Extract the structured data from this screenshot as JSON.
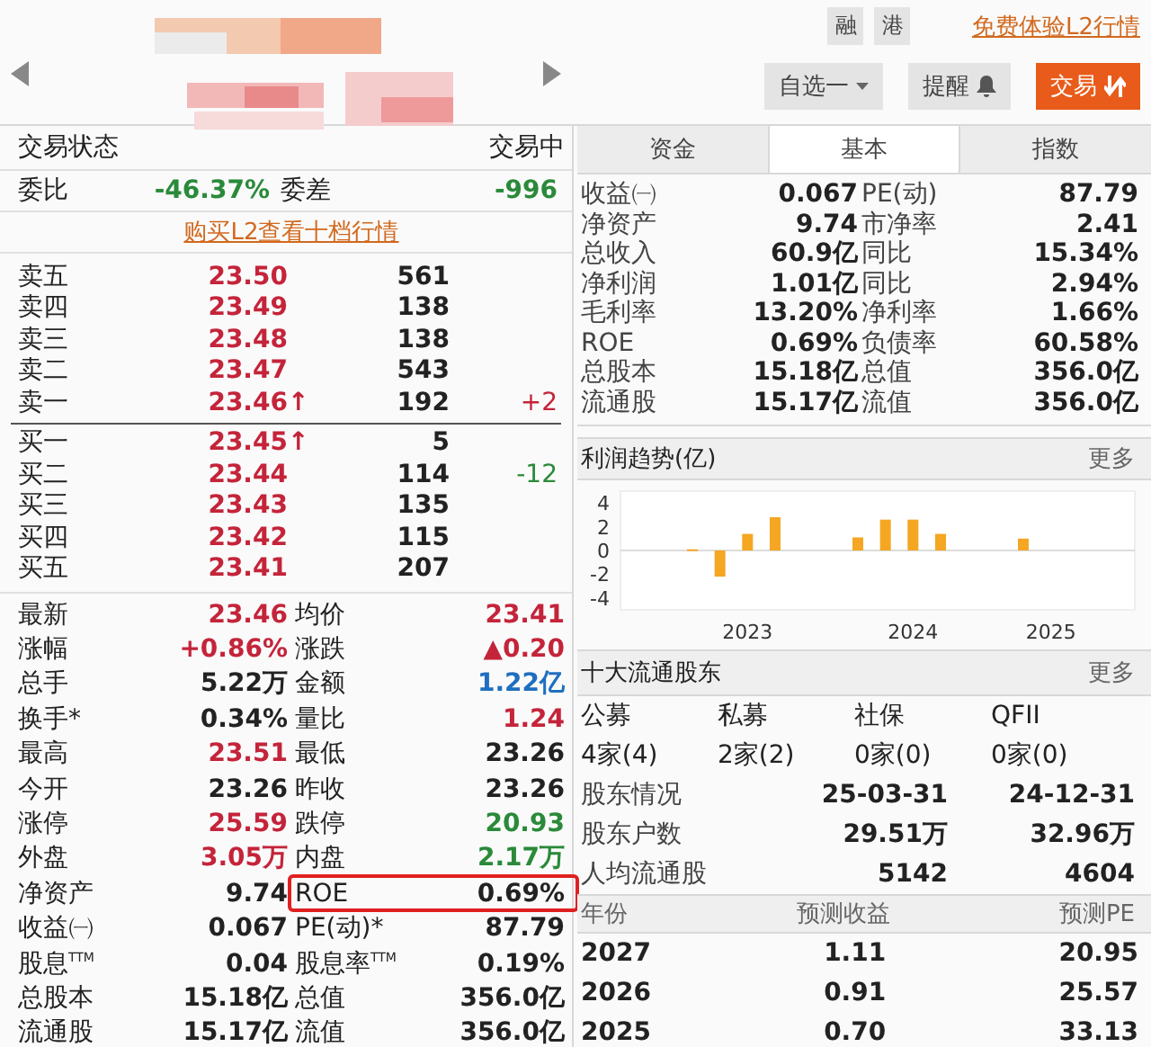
{
  "header": {
    "tags": [
      "融",
      "港"
    ],
    "promo_link": "免费体验L2行情",
    "watchlist_button": "自选一",
    "alert_button": "提醒",
    "trade_button": "交易"
  },
  "status": {
    "label": "交易状态",
    "value": "交易中"
  },
  "order_ratio": [
    {
      "label": "委比",
      "value": "-46.37%",
      "color": "#2a8a3a"
    },
    {
      "label": "委差",
      "value": "-996",
      "color": "#2a8a3a"
    }
  ],
  "l2_link": "购买L2查看十档行情",
  "asks": [
    {
      "label": "卖五",
      "price": "23.50",
      "volume": "561"
    },
    {
      "label": "卖四",
      "price": "23.49",
      "volume": "138"
    },
    {
      "label": "卖三",
      "price": "23.48",
      "volume": "138"
    },
    {
      "label": "卖二",
      "price": "23.47",
      "volume": "543"
    },
    {
      "label": "卖一",
      "price": "23.46",
      "arrow": "↑",
      "volume": "192",
      "change": "+2",
      "color": "#c4243a"
    }
  ],
  "bids": [
    {
      "label": "买一",
      "price": "23.45",
      "arrow": "↑",
      "volume": "5"
    },
    {
      "label": "买二",
      "price": "23.44",
      "volume": "114",
      "change": "-12",
      "color": "#2a8a3a"
    },
    {
      "label": "买三",
      "price": "23.43",
      "volume": "135"
    },
    {
      "label": "买四",
      "price": "23.42",
      "volume": "115"
    },
    {
      "label": "买五",
      "price": "23.41",
      "volume": "207"
    }
  ],
  "stats": [
    {
      "highlighted": false,
      "cells": [
        {
          "label": "最新",
          "value": "23.46",
          "color": "#c4243a"
        },
        {
          "label": "均价",
          "value": "23.41",
          "color": "#c4243a"
        }
      ]
    },
    {
      "highlighted": false,
      "cells": [
        {
          "label": "涨幅",
          "value": "+0.86%",
          "color": "#c4243a"
        },
        {
          "label": "涨跌",
          "value": "▲0.20",
          "color": "#c4243a"
        }
      ]
    },
    {
      "highlighted": false,
      "cells": [
        {
          "label": "总手",
          "value": "5.22万",
          "color": "#222222"
        },
        {
          "label": "金额",
          "value": "1.22亿",
          "color": "#1f6fc0"
        }
      ]
    },
    {
      "highlighted": false,
      "cells": [
        {
          "label": "换手*",
          "value": "0.34%",
          "color": "#222222"
        },
        {
          "label": "量比",
          "value": "1.24",
          "color": "#c4243a"
        }
      ]
    },
    {
      "highlighted": false,
      "cells": [
        {
          "label": "最高",
          "value": "23.51",
          "color": "#c4243a"
        },
        {
          "label": "最低",
          "value": "23.26",
          "color": "#222222"
        }
      ]
    },
    {
      "highlighted": false,
      "cells": [
        {
          "label": "今开",
          "value": "23.26",
          "color": "#222222"
        },
        {
          "label": "昨收",
          "value": "23.26",
          "color": "#222222"
        }
      ]
    },
    {
      "highlighted": false,
      "cells": [
        {
          "label": "涨停",
          "value": "25.59",
          "color": "#c4243a"
        },
        {
          "label": "跌停",
          "value": "20.93",
          "color": "#2a8a3a"
        }
      ]
    },
    {
      "highlighted": false,
      "cells": [
        {
          "label": "外盘",
          "value": "3.05万",
          "color": "#c4243a"
        },
        {
          "label": "内盘",
          "value": "2.17万",
          "color": "#2a8a3a"
        }
      ]
    },
    {
      "highlighted": true,
      "cells": [
        {
          "label": "净资产",
          "value": "9.74",
          "color": "#222222"
        },
        {
          "label": "ROE",
          "value": "0.69%",
          "color": "#222222"
        }
      ]
    },
    {
      "highlighted": false,
      "cells": [
        {
          "label": "收益㈠",
          "value": "0.067",
          "color": "#222222"
        },
        {
          "label": "PE(动)*",
          "value": "87.79",
          "color": "#222222"
        }
      ]
    },
    {
      "highlighted": false,
      "cells": [
        {
          "label": "股息$^{TTM}$",
          "value": "0.04",
          "color": "#222222"
        },
        {
          "label": "股息率$^{TTM}$",
          "value": "0.19%",
          "color": "#222222"
        }
      ]
    },
    {
      "highlighted": false,
      "cells": [
        {
          "label": "总股本",
          "value": "15.18亿",
          "color": "#222222"
        },
        {
          "label": "总值",
          "value": "356.0亿",
          "color": "#222222"
        }
      ]
    },
    {
      "highlighted": false,
      "cells": [
        {
          "label": "流通股",
          "value": "15.17亿",
          "color": "#222222"
        },
        {
          "label": "流值",
          "value": "356.0亿",
          "color": "#222222"
        }
      ]
    }
  ],
  "tabs": [
    {
      "label": "资金",
      "selected": false
    },
    {
      "label": "基本",
      "selected": true
    },
    {
      "label": "指数",
      "selected": false
    }
  ],
  "fundamentals": [
    {
      "label": "收益㈠",
      "value": "0.067",
      "label2": "PE(动)",
      "value2": "87.79"
    },
    {
      "label": "净资产",
      "value": "9.74",
      "label2": "市净率",
      "value2": "2.41"
    },
    {
      "label": "总收入",
      "value": "60.9亿",
      "label2": "同比",
      "value2": "15.34%"
    },
    {
      "label": "净利润",
      "value": "1.01亿",
      "label2": "同比",
      "value2": "2.94%"
    },
    {
      "label": "毛利率",
      "value": "13.20%",
      "label2": "净利率",
      "value2": "1.66%"
    },
    {
      "label": "ROE",
      "value": "0.69%",
      "label2": "负债率",
      "value2": "60.58%"
    },
    {
      "label": "总股本",
      "value": "15.18亿",
      "label2": "总值",
      "value2": "356.0亿"
    },
    {
      "label": "流通股",
      "value": "15.17亿",
      "label2": "流值",
      "value2": "356.0亿"
    }
  ],
  "profit_trend": {
    "title": "利润趋势(亿)",
    "more": "更多",
    "chart_data": {
      "type": "bar",
      "categories": [
        null,
        null,
        "2023",
        null,
        null,
        null,
        null,
        null,
        "2024",
        null,
        null,
        null,
        null,
        "2025",
        null
      ],
      "series": [
        {
          "color": "#f5a623",
          "values": [
            0.1,
            -2.2,
            1.4,
            2.8,
            null,
            null,
            1.1,
            2.6,
            2.6,
            1.4,
            null,
            null,
            1.0,
            null,
            null
          ]
        }
      ],
      "ylim": [
        -5,
        5
      ],
      "yticks": [
        4,
        2,
        0,
        -2,
        -4
      ]
    }
  },
  "shareholders": {
    "title": "十大流通股东",
    "more": "更多",
    "groups": [
      {
        "label": "公募",
        "value": "4家(4)"
      },
      {
        "label": "私募",
        "value": "2家(2)"
      },
      {
        "label": "社保",
        "value": "0家(0)"
      },
      {
        "label": "QFII",
        "value": "0家(0)"
      }
    ],
    "rows": [
      {
        "label": "股东情况",
        "values": [
          "25-03-31",
          "24-12-31"
        ]
      },
      {
        "label": "股东户数",
        "values": [
          "29.51万",
          "32.96万"
        ]
      },
      {
        "label": "人均流通股",
        "values": [
          "5142",
          "4604"
        ]
      }
    ]
  },
  "forecast": {
    "columns": [
      "年份",
      "预测收益",
      "预测PE"
    ],
    "rows": [
      [
        "2027",
        "1.11",
        "20.95"
      ],
      [
        "2026",
        "0.91",
        "25.57"
      ],
      [
        "2025",
        "0.70",
        "33.13"
      ]
    ]
  }
}
